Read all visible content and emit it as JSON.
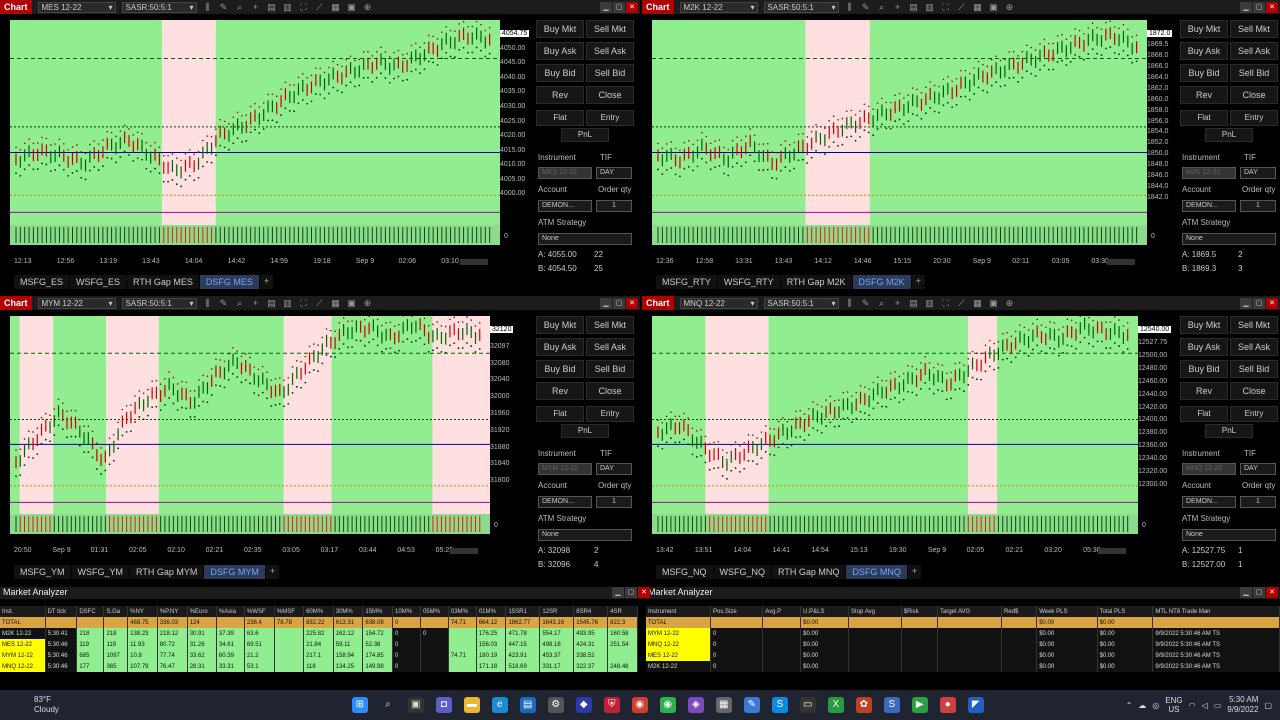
{
  "charts": [
    {
      "label": "Chart",
      "instrument": "MES 12-22",
      "template": "SASR:50:5:1",
      "prices": [
        "4054.75",
        "4050.00",
        "4045.00",
        "4040.00",
        "4035.00",
        "4030.00",
        "4025.00",
        "4020.00",
        "4015.00",
        "4010.00",
        "4005.00",
        "4000.00"
      ],
      "times": [
        "12:13",
        "12:56",
        "13:19",
        "13:43",
        "14:04",
        "14:42",
        "14:59",
        "19:18",
        "Sep 9",
        "02:06",
        "03:10"
      ],
      "tabs": [
        "MSFG_ES",
        "WSFG_ES",
        "RTH Gap MES",
        "DSFG MES"
      ],
      "active_tab": 3,
      "bid_ask": {
        "ask": "A: 4055.00",
        "ask_size": "22",
        "bid": "B: 4054.50",
        "bid_size": "25"
      },
      "instrument_field": "MES 12-22"
    },
    {
      "label": "Chart",
      "instrument": "M2K 12-22",
      "template": "SASR:50:5:1",
      "prices": [
        "1872.0",
        "1869.5",
        "1868.0",
        "1866.0",
        "1864.0",
        "1862.0",
        "1860.0",
        "1858.0",
        "1856.0",
        "1854.0",
        "1852.0",
        "1850.0",
        "1848.0",
        "1846.0",
        "1844.0",
        "1842.0"
      ],
      "times": [
        "12:36",
        "12:58",
        "13:31",
        "13:43",
        "14:12",
        "14:46",
        "15:15",
        "20:30",
        "Sep 9",
        "02:11",
        "03:05",
        "03:30"
      ],
      "tabs": [
        "MSFG_RTY",
        "WSFG_RTY",
        "RTH Gap M2K",
        "DSFG M2K"
      ],
      "active_tab": 3,
      "bid_ask": {
        "ask": "A: 1869.5",
        "ask_size": "2",
        "bid": "B: 1869.3",
        "bid_size": "3"
      },
      "instrument_field": "M2K 12-22"
    },
    {
      "label": "Chart",
      "instrument": "MYM 12-22",
      "template": "SASR:50:5:1",
      "prices": [
        "32120",
        "32097",
        "32080",
        "32040",
        "32000",
        "31960",
        "31920",
        "31880",
        "31840",
        "31800"
      ],
      "times": [
        "20:50",
        "Sep 9",
        "01:31",
        "02:05",
        "02:10",
        "02:21",
        "02:35",
        "03:05",
        "03:17",
        "03:44",
        "04:53",
        "05:25"
      ],
      "tabs": [
        "MSFG_YM",
        "WSFG_YM",
        "RTH Gap MYM",
        "DSFG MYM"
      ],
      "active_tab": 3,
      "bid_ask": {
        "ask": "A: 32098",
        "ask_size": "2",
        "bid": "B: 32096",
        "bid_size": "4"
      },
      "instrument_field": "MYM 12-22"
    },
    {
      "label": "Chart",
      "instrument": "MNQ 12-22",
      "template": "SASR:50:5:1",
      "prices": [
        "12540.00",
        "12527.75",
        "12500.00",
        "12480.00",
        "12460.00",
        "12440.00",
        "12420.00",
        "12400.00",
        "12380.00",
        "12360.00",
        "12340.00",
        "12320.00",
        "12300.00"
      ],
      "times": [
        "13:42",
        "13:51",
        "14:04",
        "14:41",
        "14:54",
        "15:13",
        "19:30",
        "Sep 9",
        "02:05",
        "02:21",
        "03:20",
        "05:30"
      ],
      "tabs": [
        "MSFG_NQ",
        "WSFG_NQ",
        "RTH Gap MNQ",
        "DSFG MNQ"
      ],
      "active_tab": 3,
      "bid_ask": {
        "ask": "A: 12527.75",
        "ask_size": "1",
        "bid": "B: 12527.00",
        "bid_size": "1"
      },
      "instrument_field": "MNQ 12-22"
    }
  ],
  "trade": {
    "buy_mkt": "Buy Mkt",
    "sell_mkt": "Sell Mkt",
    "buy_ask": "Buy Ask",
    "sell_ask": "Sell Ask",
    "buy_bid": "Buy Bid",
    "sell_bid": "Sell Bid",
    "rev": "Rev",
    "close": "Close",
    "flat": "Flat",
    "entry": "Entry",
    "pnl": "PnL",
    "instrument": "Instrument",
    "tif": "TIF",
    "tif_value": "DAY",
    "account": "Account",
    "order_qty": "Order qty",
    "account_value": "DEMON...",
    "qty": "1",
    "atm": "ATM Strategy",
    "atm_value": "None"
  },
  "analyzer_left": {
    "title": "Market Analyzer",
    "headers": [
      "Inst.",
      "DT tick",
      "DSFC",
      "S.Ga",
      "%NY",
      "%P.NY",
      "%Euro",
      "%Asia",
      "%WSF",
      "%MSF",
      "60M%",
      "30M%",
      "15M%",
      "10M%",
      "05M%",
      "03M%",
      "01M%",
      "15SR1",
      "12SR",
      "8SR4",
      "4SR"
    ],
    "rows": [
      [
        "TOTAL",
        "",
        "",
        "",
        "468.75",
        "336.03",
        "124",
        "",
        "238.4",
        "78.78",
        "832.22",
        "613.31",
        "638.08",
        "0",
        "",
        "74.71",
        "664.12",
        "1862.77",
        "1643.16",
        "1545.76",
        "822.3"
      ],
      [
        "M2K 12-22",
        "5:30:41",
        "218",
        "218",
        "138.23",
        "218.12",
        "30.91",
        "37.39",
        "63.6",
        "",
        "225.82",
        "162.12",
        "154.72",
        "0",
        "0",
        "",
        "176.25",
        "471.78",
        "554.17",
        "493.95",
        "160.58"
      ],
      [
        "MES 12-22",
        "5:30:46",
        "119",
        "119",
        "11.93",
        "80.72",
        "31.26",
        "34.61",
        "69.51",
        "",
        "21.84",
        "59.11",
        "52.38",
        "0",
        "",
        "",
        "156.03",
        "447.15",
        "498.18",
        "424.31",
        "251.54"
      ],
      [
        "MYM 12-22",
        "5:30:46",
        "685",
        "1097",
        "10.8",
        "77.74",
        "33.62",
        "60.39",
        "21.2",
        "",
        "217.1",
        "158.94",
        "174.85",
        "0",
        "",
        "74.71",
        "180.19",
        "423.91",
        "453.37",
        "338.52",
        ""
      ],
      [
        "MNQ 12-22",
        "5:30:46",
        "177",
        "365",
        "107.79",
        "76.47",
        "28.31",
        "33.31",
        "53.1",
        "",
        "118",
        "134.25",
        "149.98",
        "0",
        "",
        "",
        "171.18",
        "518.69",
        "331.17",
        "322.37",
        "248.48"
      ]
    ]
  },
  "analyzer_right": {
    "title": "Market Analyzer",
    "headers": [
      "Instrument",
      "Pos.Size",
      "Avg.P",
      "U.P&LS",
      "Stop Avg",
      "$Risk",
      "Target AVG",
      "Red$",
      "Week PLS",
      "Total PLS",
      "MTL NT8 Trade Man"
    ],
    "rows": [
      [
        "TOTAL",
        "",
        "",
        "$0.00",
        "",
        "",
        "",
        "",
        "$0.00",
        "$0.00",
        ""
      ],
      [
        "MYM 12-22",
        "0",
        "",
        "$0.00",
        "",
        "",
        "",
        "",
        "$0.00",
        "$0.00",
        "9/9/2022 5:30:46 AM TS"
      ],
      [
        "MNQ 12-22",
        "0",
        "",
        "$0.00",
        "",
        "",
        "",
        "",
        "$0.00",
        "$0.00",
        "9/9/2022 5:30:46 AM TS"
      ],
      [
        "MES 12-22",
        "0",
        "",
        "$0.00",
        "",
        "",
        "",
        "",
        "$0.00",
        "$0.00",
        "9/9/2022 5:30:46 AM TS"
      ],
      [
        "M2K 12-22",
        "0",
        "",
        "$0.00",
        "",
        "",
        "",
        "",
        "$0.00",
        "$0.00",
        "9/9/2022 5:30:46 AM TS"
      ]
    ]
  },
  "taskbar": {
    "temp": "83°F",
    "weather": "Cloudy",
    "lang": "ENG",
    "region": "US",
    "time": "5:30 AM",
    "date": "9/9/2022"
  },
  "colors": {
    "chart_bg": "#90ee90",
    "session_bg": "#ffe0e0",
    "red_label": "#b00000",
    "yellow": "#ffff00",
    "green": "#90ee90"
  }
}
